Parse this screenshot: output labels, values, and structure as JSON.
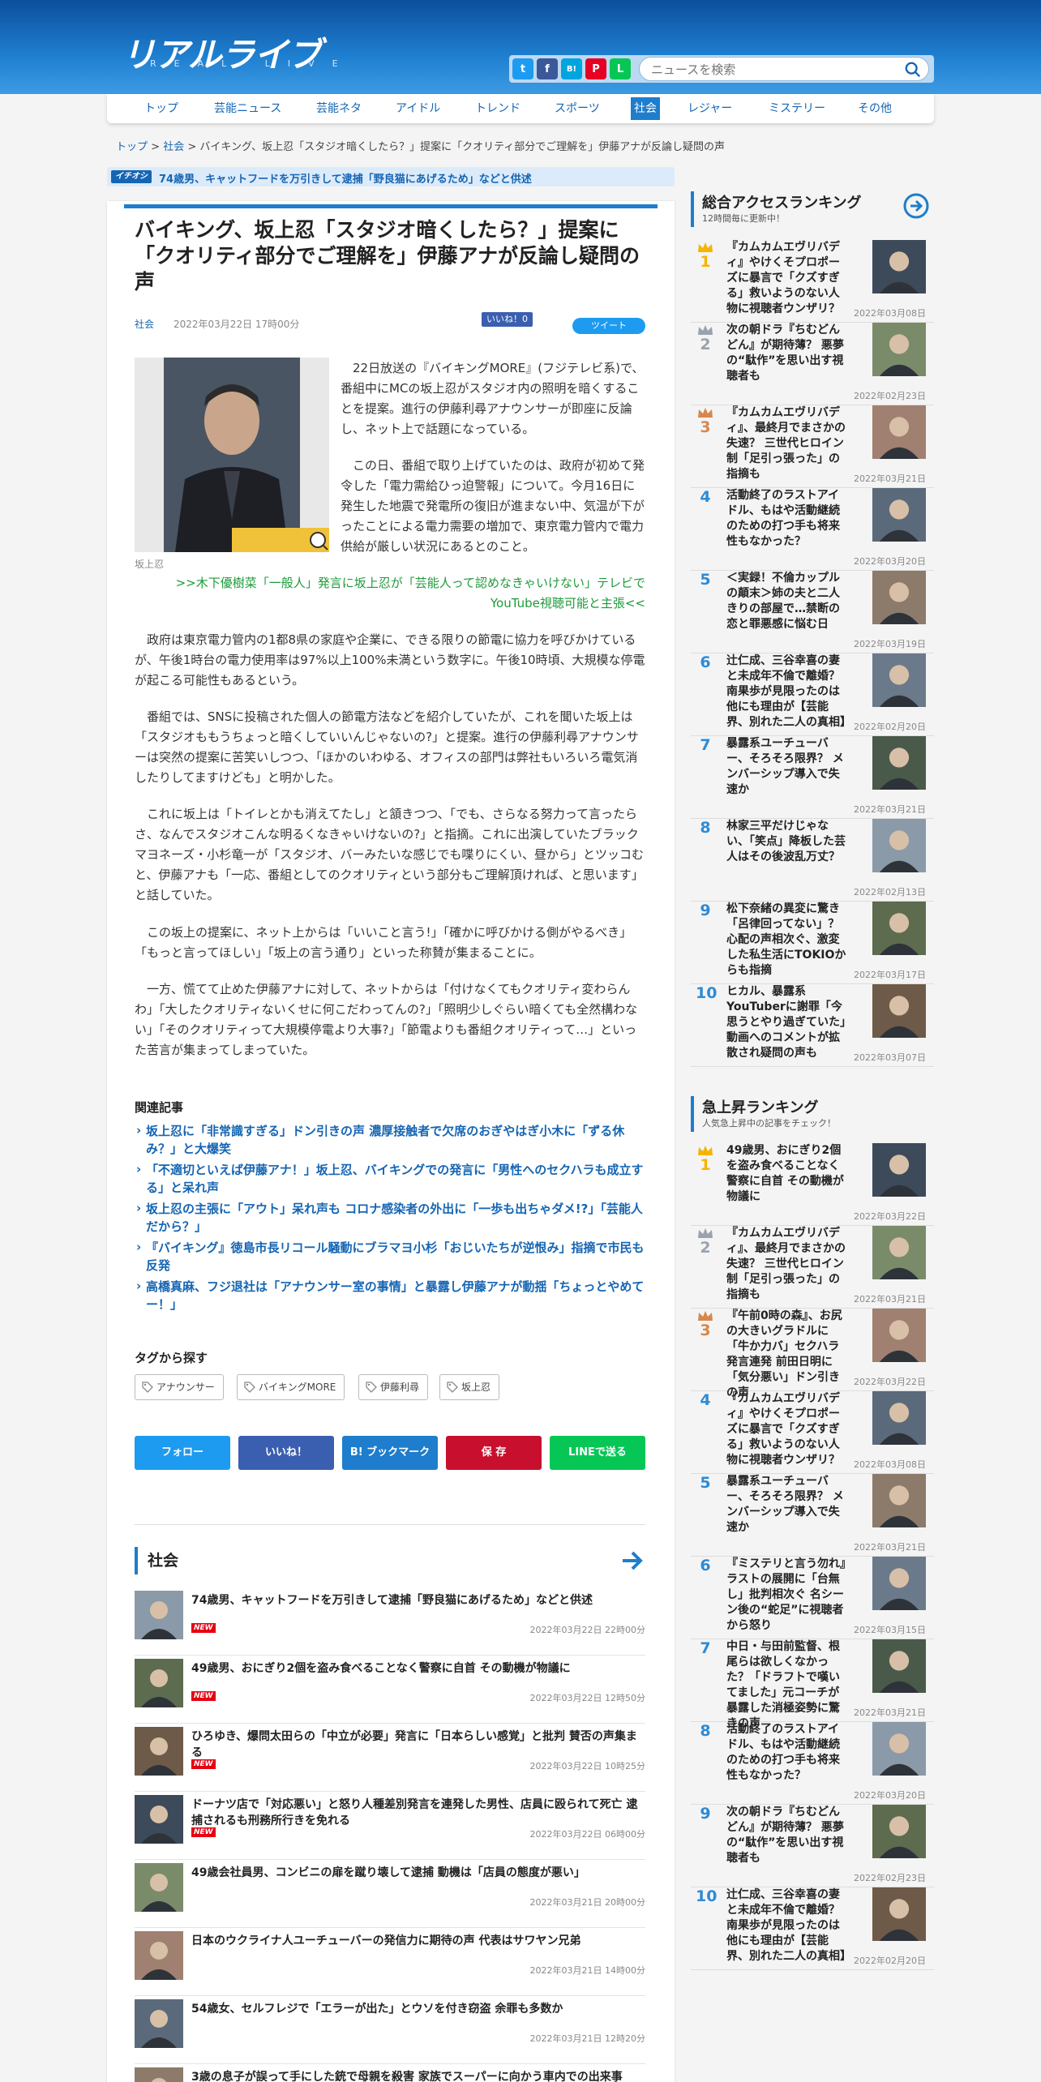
{
  "site": {
    "logo": "リアルライブ",
    "logo_sub": "REAL LIVE"
  },
  "search": {
    "placeholder": "ニュースを検索"
  },
  "share_icons": [
    {
      "name": "twitter",
      "label": "t",
      "color": "#1d9bf0"
    },
    {
      "name": "facebook",
      "label": "f",
      "color": "#3b5998"
    },
    {
      "name": "hatena",
      "label": "B!",
      "color": "#00a4de"
    },
    {
      "name": "pinterest",
      "label": "P",
      "color": "#e60023"
    },
    {
      "name": "line",
      "label": "L",
      "color": "#06c755"
    }
  ],
  "nav": [
    "トップ",
    "芸能ニュース",
    "芸能ネタ",
    "アイドル",
    "トレンド",
    "スポーツ",
    "社会",
    "レジャー",
    "ミステリー",
    "その他"
  ],
  "breadcrumb": {
    "top": "トップ",
    "sep1": " > ",
    "cat": "社会",
    "sep2": " > ",
    "current": "バイキング、坂上忍「スタジオ暗くしたら？」提案に「クオリティ部分でご理解を」伊藤アナが反論し疑問の声"
  },
  "pickup": {
    "badge": "イチオシ",
    "text": "74歳男、キャットフードを万引きして逮捕「野良猫にあげるため」などと供述"
  },
  "article": {
    "title": "バイキング、坂上忍「スタジオ暗くしたら？」提案に「クオリティ部分でご理解を」伊藤アナが反論し疑問の声",
    "category": "社会",
    "date": "2022年03月22日 17時00分",
    "like": "いいね！0",
    "tweet": "ツイート",
    "photo_caption": "坂上忍",
    "p1": "22日放送の『バイキングMORE』(フジテレビ系)で、番組中にMCの坂上忍がスタジオ内の照明を暗くすることを提案。進行の伊藤利尋アナウンサーが即座に反論し、ネット上で話題になっている。",
    "p2": "この日、番組で取り上げていたのは、政府が初めて発令した「電力需給ひっ迫警報」について。今月16日に発生した地震で発電所の復旧が進まない中、気温が下がったことによる電力需要の増加で、東京電力管内で電力供給が厳しい状況にあるとのこと。",
    "rel_link": ">>木下優樹菜「一般人」発言に坂上忍が「芸能人って認めなきゃいけない」テレビでYouTube視聴可能と主張<<",
    "p3": "政府は東京電力管内の1都8県の家庭や企業に、できる限りの節電に協力を呼びかけているが、午後1時台の電力使用率は97%以上100%未満という数字に。午後10時頃、大規模な停電が起こる可能性もあるという。",
    "p4": "番組では、SNSに投稿された個人の節電方法などを紹介していたが、これを聞いた坂上は「スタジオももうちょっと暗くしていいんじゃないの?」と提案。進行の伊藤利尋アナウンサーは突然の提案に苦笑いしつつ、「ほかのいわゆる、オフィスの部門は弊社もいろいろ電気消したりしてますけども」と明かした。",
    "p5": "これに坂上は「トイレとかも消えてたし」と頷きつつ、「でも、さらなる努力って言ったらさ、なんでスタジオこんな明るくなきゃいけないの?」と指摘。これに出演していたブラックマヨネーズ・小杉竜一が「スタジオ、バーみたいな感じでも喋りにくい、昼から」とツッコむと、伊藤アナも「一応、番組としてのクオリティという部分もご理解頂ければ、と思います」と話していた。",
    "p6": "この坂上の提案に、ネット上からは「いいこと言う!」「確かに呼びかける側がやるべき」「もっと言ってほしい」「坂上の言う通り」といった称賛が集まることに。",
    "p7": "一方、慌てて止めた伊藤アナに対して、ネットからは「付けなくてもクオリティ変わらんわ」「大したクオリティないくせに何こだわってんの?」「照明少しぐらい暗くても全然構わない」「そのクオリティって大規模停電より大事?」「節電よりも番組クオリティって…」といった苦言が集まってしまっていた。"
  },
  "related": {
    "title": "関連記事",
    "items": [
      "坂上忍に「非常識すぎる」ドン引きの声 濃厚接触者で欠席のおぎやはぎ小木に「ずる休み？」と大爆笑",
      "「不適切といえば伊藤アナ！」坂上忍、バイキングでの発言に「男性へのセクハラも成立する」と呆れ声",
      "坂上忍の主張に「アウト」呆れ声も コロナ感染者の外出に「一歩も出ちゃダメ!?」「芸能人だから？」",
      "『バイキング』徳島市長リコール騒動にブラマヨ小杉「おじいたちが逆恨み」指摘で市民も反発",
      "高橋真麻、フジ退社は「アナウンサー室の事情」と暴露し伊藤アナが動揺「ちょっとやめてー！」"
    ]
  },
  "tags": {
    "title": "タグから探す",
    "items": [
      "アナウンサー",
      "バイキングMORE",
      "伊藤利尋",
      "坂上忍"
    ]
  },
  "social": [
    {
      "label": "フォロー",
      "color": "#1d9bf0"
    },
    {
      "label": "いいね！",
      "color": "#3b5fb0"
    },
    {
      "label": "B! ブックマーク",
      "color": "#1e7dcc"
    },
    {
      "label": "保 存",
      "color": "#c8102e"
    },
    {
      "label": "LINEで送る",
      "color": "#06c755"
    }
  ],
  "section": {
    "title": "社会",
    "items": [
      {
        "title": "74歳男、キャットフードを万引きして逮捕「野良猫にあげるため」などと供述",
        "new": "NEW",
        "date": "2022年03月22日 22時00分"
      },
      {
        "title": "49歳男、おにぎり2個を盗み食べることなく警察に自首 その動機が物議に",
        "new": "NEW",
        "date": "2022年03月22日 12時50分"
      },
      {
        "title": "ひろゆき、爆問太田らの「中立が必要」発言に「日本らしい感覚」と批判 賛否の声集まる",
        "new": "NEW",
        "date": "2022年03月22日 10時25分"
      },
      {
        "title": "ドーナツ店で「対応悪い」と怒り人種差別発言を連発した男性、店員に殴られて死亡 逮捕されるも刑務所行きを免れる",
        "new": "NEW",
        "date": "2022年03月22日 06時00分"
      },
      {
        "title": "49歳会社員男、コンビニの扉を蹴り壊して逮捕 動機は「店員の態度が悪い」",
        "new": "",
        "date": "2022年03月21日 20時00分"
      },
      {
        "title": "日本のウクライナ人ユーチューバーの発信力に期待の声 代表はサワヤン兄弟",
        "new": "",
        "date": "2022年03月21日 14時00分"
      },
      {
        "title": "54歳女、セルフレジで「エラーが出た」とウソを付き窃盗 余罪も多数か",
        "new": "",
        "date": "2022年03月21日 12時20分"
      },
      {
        "title": "3歳の息子が誤って手にした銃で母親を殺害 家族でスーパーに向かう車内での出来事",
        "new": "",
        "date": ""
      }
    ]
  },
  "ranking_access": {
    "title": "総合アクセスランキング",
    "sub": "12時間毎に更新中！",
    "items": [
      {
        "num": "1",
        "title": "『カムカムエヴリバディ』やけくそプロポーズに暴言で「クズすぎる」救いようのない人物に視聴者ウンザリ？",
        "date": "2022年03月08日"
      },
      {
        "num": "2",
        "title": "次の朝ドラ『ちむどんどん』が期待薄？ 悪夢の“駄作”を思い出す視聴者も",
        "date": "2022年02月23日"
      },
      {
        "num": "3",
        "title": "『カムカムエヴリバディ』、最終月でまさかの失速？ 三世代ヒロイン制「足引っ張った」の指摘も",
        "date": "2022年03月21日"
      },
      {
        "num": "4",
        "title": "活動終了のラストアイドル、もはや活動継続のための打つ手も将来性もなかった？",
        "date": "2022年03月20日"
      },
      {
        "num": "5",
        "title": "＜実録！不倫カップルの顛末＞姉の夫と二人きりの部屋で…禁断の恋と罪悪感に悩む日",
        "date": "2022年03月19日"
      },
      {
        "num": "6",
        "title": "辻仁成、三谷幸喜の妻と未成年不倫で離婚？ 南果歩が見限ったのは他にも理由が【芸能界、別れた二人の真相】",
        "date": "2022年02月20日"
      },
      {
        "num": "7",
        "title": "暴露系ユーチューバー、そろそろ限界？ メンバーシップ導入で失速か",
        "date": "2022年03月21日"
      },
      {
        "num": "8",
        "title": "林家三平だけじゃない、「笑点」降板した芸人はその後波乱万丈？",
        "date": "2022年02月13日"
      },
      {
        "num": "9",
        "title": "松下奈緒の異変に驚き「呂律回ってない」？ 心配の声相次ぐ、激変した私生活にTOKIOからも指摘",
        "date": "2022年03月17日"
      },
      {
        "num": "10",
        "title": "ヒカル、暴露系YouTuberに謝罪「今思うとやり過ぎていた」動画へのコメントが拡散され疑問の声も",
        "date": "2022年03月07日"
      }
    ]
  },
  "ranking_rising": {
    "title": "急上昇ランキング",
    "sub": "人気急上昇中の記事をチェック！",
    "items": [
      {
        "num": "1",
        "title": "49歳男、おにぎり2個を盗み食べることなく警察に自首 その動機が物議に",
        "date": "2022年03月22日"
      },
      {
        "num": "2",
        "title": "『カムカムエヴリバディ』、最終月でまさかの失速？ 三世代ヒロイン制「足引っ張った」の指摘も",
        "date": "2022年03月21日"
      },
      {
        "num": "3",
        "title": "『午前0時の森』、お尻の大きいグラドルに「牛か力バ」セクハラ発言連発 前田日明に「気分悪い」ドン引きの声",
        "date": "2022年03月22日"
      },
      {
        "num": "4",
        "title": "『カムカムエヴリバディ』やけくそプロポーズに暴言で「クズすぎる」救いようのない人物に視聴者ウンザリ？",
        "date": "2022年03月08日"
      },
      {
        "num": "5",
        "title": "暴露系ユーチューバー、そろそろ限界？ メンバーシップ導入で失速か",
        "date": "2022年03月21日"
      },
      {
        "num": "6",
        "title": "『ミステリと言う勿れ』ラストの展開に「台無し」批判相次ぐ 名シーン後の“蛇足”に視聴者から怒り",
        "date": "2022年03月15日"
      },
      {
        "num": "7",
        "title": "中日・与田前監督、根尾らは欲しくなかった？「ドラフトで嘆いてました」元コーチが暴露した消極姿勢に驚きの声",
        "date": "2022年03月21日"
      },
      {
        "num": "8",
        "title": "活動終了のラストアイドル、もはや活動継続のための打つ手も将来性もなかった？",
        "date": "2022年03月20日"
      },
      {
        "num": "9",
        "title": "次の朝ドラ『ちむどんどん』が期待薄？ 悪夢の“駄作”を思い出す視聴者も",
        "date": "2022年02月23日"
      },
      {
        "num": "10",
        "title": "辻仁成、三谷幸喜の妻と未成年不倫で離婚？ 南果歩が見限ったのは他にも理由が【芸能界、別れた二人の真相】",
        "date": "2022年02月20日"
      }
    ]
  }
}
